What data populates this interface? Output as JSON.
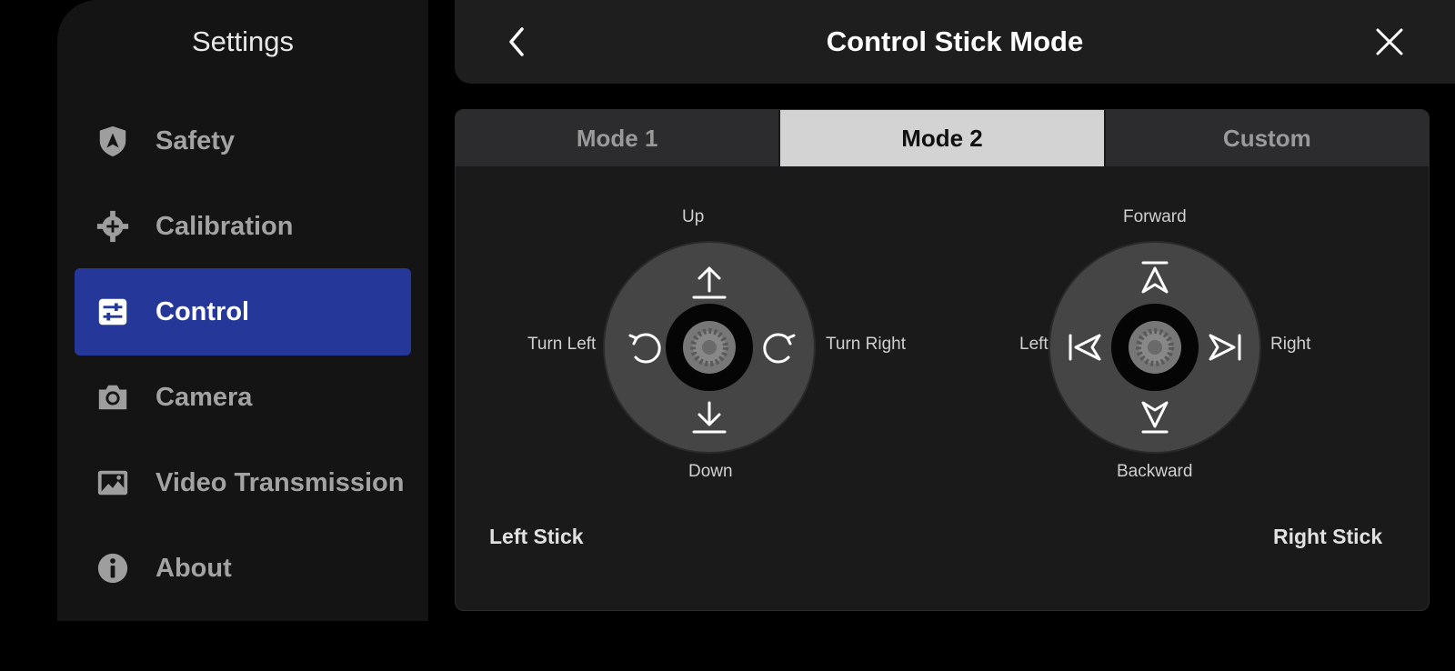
{
  "sidebar": {
    "title": "Settings",
    "items": [
      {
        "label": "Safety",
        "icon": "shield-icon",
        "active": false
      },
      {
        "label": "Calibration",
        "icon": "crosshair-icon",
        "active": false
      },
      {
        "label": "Control",
        "icon": "sliders-icon",
        "active": true
      },
      {
        "label": "Camera",
        "icon": "camera-icon",
        "active": false
      },
      {
        "label": "Video Transmission",
        "icon": "image-icon",
        "active": false
      },
      {
        "label": "About",
        "icon": "info-icon",
        "active": false
      }
    ]
  },
  "header": {
    "title": "Control Stick Mode",
    "back_icon": "chevron-left-icon",
    "close_icon": "close-icon"
  },
  "tabs": [
    {
      "label": "Mode 1",
      "active": false
    },
    {
      "label": "Mode 2",
      "active": true
    },
    {
      "label": "Custom",
      "active": false
    }
  ],
  "left_stick": {
    "name": "Left Stick",
    "up": "Up",
    "down": "Down",
    "left": "Turn Left",
    "right": "Turn Right"
  },
  "right_stick": {
    "name": "Right Stick",
    "up": "Forward",
    "down": "Backward",
    "left": "Left",
    "right": "Right"
  },
  "colors": {
    "accent": "#25389a",
    "background": "#000000",
    "sidebar": "#141414",
    "panel": "#1a1a1a",
    "tab_active": "#d3d3d3",
    "tab_inactive": "#2c2c2e"
  }
}
